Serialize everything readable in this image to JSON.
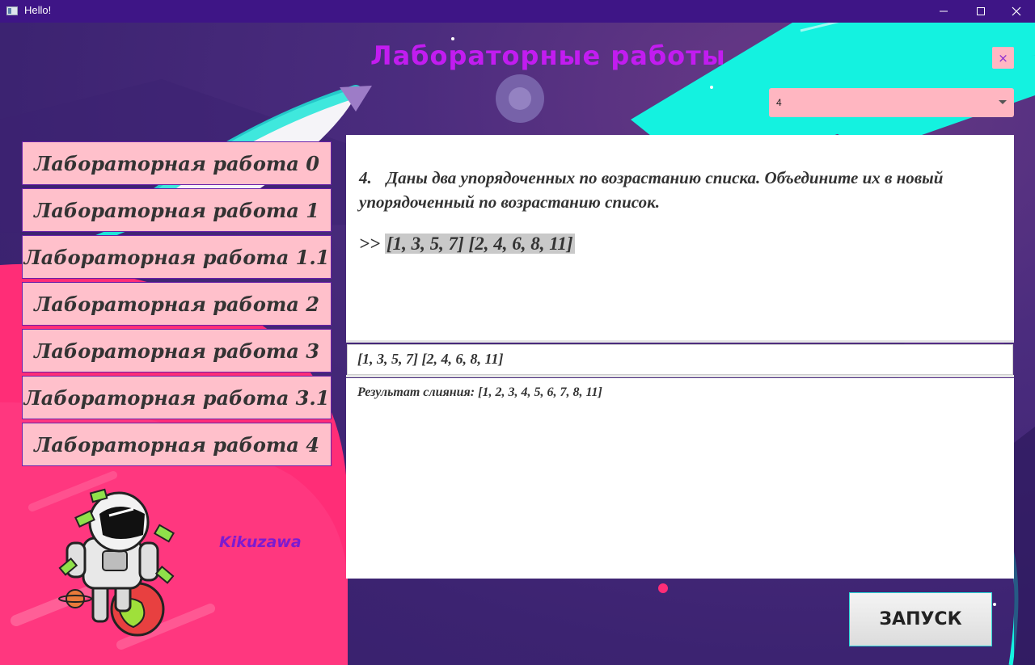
{
  "window": {
    "title": "Hello!"
  },
  "header": {
    "title": "Лабораторные работы",
    "close_label": "×"
  },
  "task_select": {
    "value": "4"
  },
  "sidebar": {
    "items": [
      {
        "label": "Лабораторная работа 0"
      },
      {
        "label": "Лабораторная работа 1"
      },
      {
        "label": "Лабораторная работа 1.1"
      },
      {
        "label": "Лабораторная работа 2"
      },
      {
        "label": "Лабораторная работа 3"
      },
      {
        "label": "Лабораторная работа 3.1"
      },
      {
        "label": "Лабораторная работа 4"
      }
    ],
    "author": "Kikuzawa"
  },
  "task": {
    "number": "4.",
    "description": "Даны два упорядоченных по возрастанию списка. Объедините их в новый упорядоченный по возрастанию список.",
    "example_prompt": ">>",
    "example_input": "[1, 3, 5, 7] [2, 4, 6, 8, 11]"
  },
  "input": {
    "value": "[1, 3, 5, 7] [2, 4, 6, 8, 11]"
  },
  "output": {
    "text": "Результат слияния: [1, 2, 3, 4, 5, 6, 7, 8, 11]"
  },
  "run_button": {
    "label": "ЗАПУСК"
  },
  "colors": {
    "title": "#c21cf0",
    "accent_cyan": "#14f2e0",
    "pink": "#ffc0cb",
    "hot_pink": "#ff2d77"
  }
}
